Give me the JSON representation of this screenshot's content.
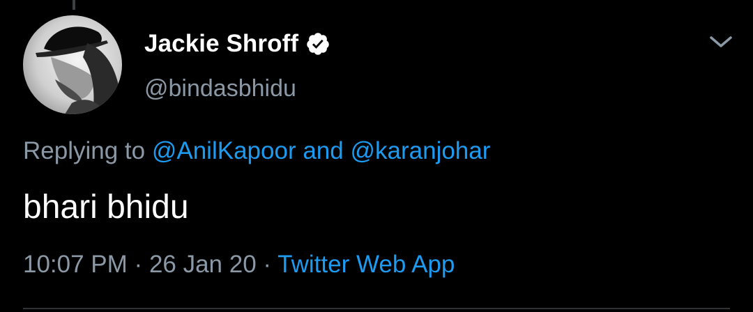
{
  "tweet": {
    "display_name": "Jackie Shroff",
    "handle": "@bindasbhidu",
    "replying_prefix": "Replying to",
    "mention_1": "@AnilKapoor",
    "mention_joiner": "and",
    "mention_2": "@karanjohar",
    "text": "bhari bhidu",
    "time": "10:07 PM",
    "separator": "·",
    "date": "26 Jan 20",
    "source": "Twitter Web App"
  },
  "icons": {
    "verified": "verified-badge-icon",
    "menu": "chevron-down-icon",
    "avatar": "profile-photo"
  },
  "colors": {
    "background": "#000000",
    "name": "#ffffff",
    "secondary": "#8b98a5",
    "link": "#1d9bf0",
    "divider": "#2f3336"
  }
}
